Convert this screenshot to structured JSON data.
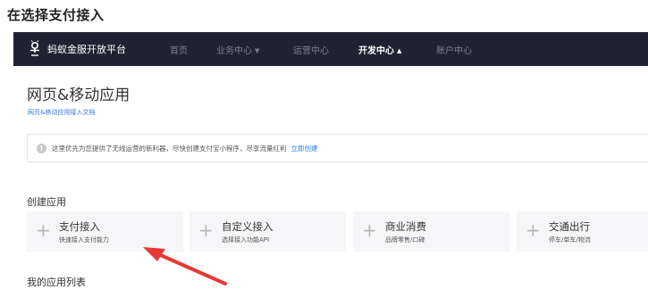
{
  "page": {
    "heading": "在选择支付接入"
  },
  "navbar": {
    "brand": "蚂蚁金服开放平台",
    "items": [
      {
        "label": "首页",
        "caret": ""
      },
      {
        "label": "业务中心",
        "caret": "▼"
      },
      {
        "label": "运营中心",
        "caret": ""
      },
      {
        "label": "开发中心",
        "caret": "▲"
      },
      {
        "label": "账户中心",
        "caret": ""
      }
    ],
    "active_index": 3
  },
  "main": {
    "title": "网页&移动应用",
    "doc_link": "网页&移动应用接入文档",
    "notice": {
      "icon": "info-icon",
      "text": "这里优先为您提供了无线运营的新利器，尽快创建支付宝小程序，尽享流量红利",
      "link": "立即创建"
    },
    "create_title": "创建应用",
    "cards": [
      {
        "name": "支付接入",
        "desc": "快速接入支付能力"
      },
      {
        "name": "自定义接入",
        "desc": "选择接入功能API"
      },
      {
        "name": "商业消费",
        "desc": "品牌零售/口碑"
      },
      {
        "name": "交通出行",
        "desc": "停车/单车/物流"
      }
    ],
    "my_apps_title": "我的应用列表"
  },
  "colors": {
    "navbar_bg": "#1f2233",
    "link": "#2e7ce6",
    "card_bg": "#f6f6f8",
    "annotation_arrow": "#e53935"
  }
}
